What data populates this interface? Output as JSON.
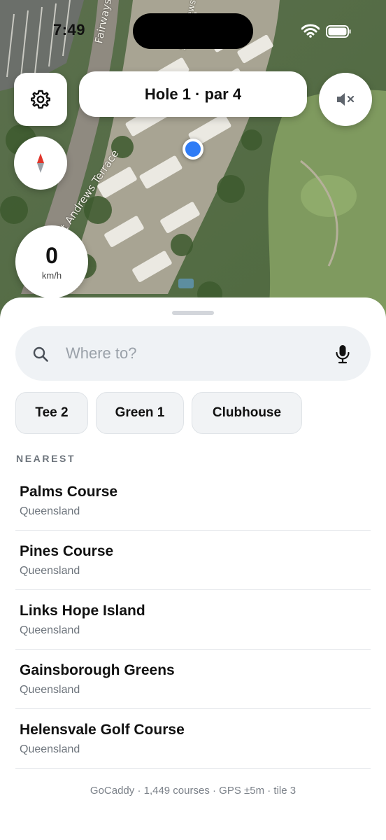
{
  "status_bar": {
    "time": "7:49"
  },
  "map": {
    "road_labels": [
      "Fairways Drive",
      "St Andrews",
      "St Andrews Terrace"
    ]
  },
  "controls": {
    "hole_label": "Hole 1 · par 4",
    "speed_value": "0",
    "speed_unit": "km/h"
  },
  "search": {
    "placeholder": "Where to?",
    "value": ""
  },
  "chips": [
    "Tee 2",
    "Green 1",
    "Clubhouse"
  ],
  "nearest": {
    "label": "NEAREST",
    "items": [
      {
        "title": "Palms Course",
        "subtitle": "Queensland"
      },
      {
        "title": "Pines Course",
        "subtitle": "Queensland"
      },
      {
        "title": "Links Hope Island",
        "subtitle": "Queensland"
      },
      {
        "title": "Gainsborough Greens",
        "subtitle": "Queensland"
      },
      {
        "title": "Helensvale Golf Course",
        "subtitle": "Queensland"
      }
    ]
  },
  "footer": "GoCaddy · 1,449 courses · GPS ±5m · tile 3",
  "colors": {
    "location_dot": "#2f7cf6",
    "compass_needle": "#e0352b"
  },
  "icons": [
    "gear-icon",
    "mute-icon",
    "compass-icon",
    "search-icon",
    "microphone-icon",
    "wifi-icon",
    "battery-icon"
  ]
}
